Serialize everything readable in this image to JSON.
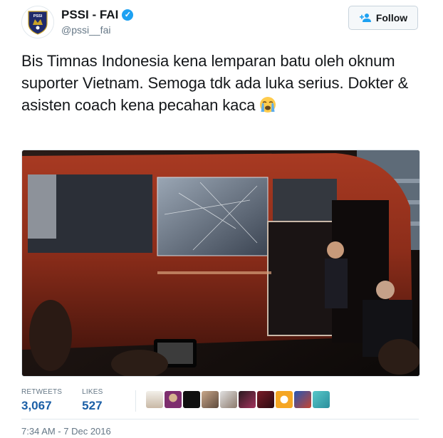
{
  "user": {
    "name": "PSSI - FAI",
    "handle": "@pssi__fai",
    "verified_icon": "verified-badge-icon",
    "avatar_icon": "pssi-logo"
  },
  "follow_button": {
    "label": "Follow",
    "icon": "add-user-icon"
  },
  "tweet": {
    "text": "Bis Timnas Indonesia kena lemparan batu oleh oknum suporter Vietnam. Semoga tdk ada luka serius. Dokter & asisten coach kena pecahan kaca",
    "emoji": "loudly-crying-face"
  },
  "photo": {
    "subject": "red team bus with shattered window at night"
  },
  "stats": {
    "retweets_label": "RETWEETS",
    "retweets": "3,067",
    "likes_label": "LIKES",
    "likes": "527"
  },
  "timestamp": "7:34 AM - 7 Dec 2016",
  "colors": {
    "link": "#1b5fa6",
    "verified": "#1da1f2",
    "muted": "#657786"
  }
}
